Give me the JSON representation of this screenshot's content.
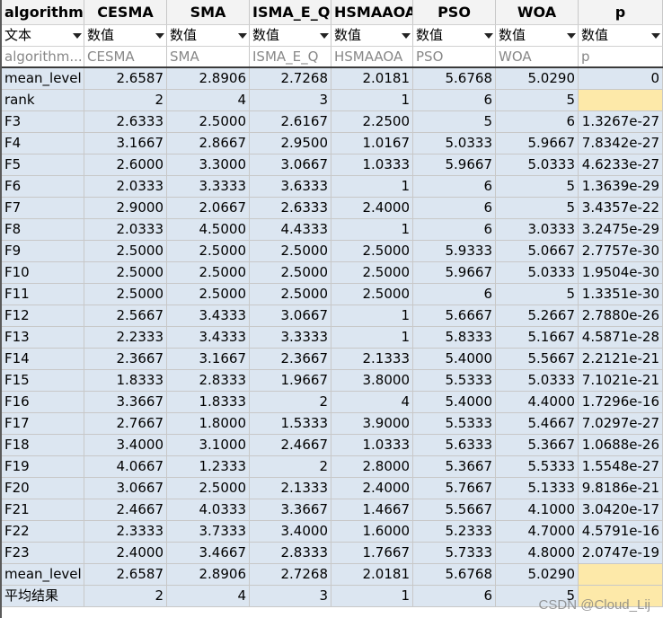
{
  "columns": [
    "algorithm...",
    "CESMA",
    "SMA",
    "ISMA_E_Q",
    "HSMAAOA",
    "PSO",
    "WOA",
    "p"
  ],
  "types": [
    "文本",
    "数值",
    "数值",
    "数值",
    "数值",
    "数值",
    "数值",
    "数值"
  ],
  "placeholders": [
    "algorithm...",
    "CESMA",
    "SMA",
    "ISMA_E_Q",
    "HSMAAOA",
    "PSO",
    "WOA",
    "p"
  ],
  "rows": [
    [
      "mean_level",
      "2.6587",
      "2.8906",
      "2.7268",
      "2.0181",
      "5.6768",
      "5.0290",
      "0"
    ],
    [
      "rank",
      "2",
      "4",
      "3",
      "1",
      "6",
      "5",
      ""
    ],
    [
      "F3",
      "2.6333",
      "2.5000",
      "2.6167",
      "2.2500",
      "5",
      "6",
      "1.3267e-27"
    ],
    [
      "F4",
      "3.1667",
      "2.8667",
      "2.9500",
      "1.0167",
      "5.0333",
      "5.9667",
      "7.8342e-27"
    ],
    [
      "F5",
      "2.6000",
      "3.3000",
      "3.0667",
      "1.0333",
      "5.9667",
      "5.0333",
      "4.6233e-27"
    ],
    [
      "F6",
      "2.0333",
      "3.3333",
      "3.6333",
      "1",
      "6",
      "5",
      "1.3639e-29"
    ],
    [
      "F7",
      "2.9000",
      "2.0667",
      "2.6333",
      "2.4000",
      "6",
      "5",
      "3.4357e-22"
    ],
    [
      "F8",
      "2.0333",
      "4.5000",
      "4.4333",
      "1",
      "6",
      "3.0333",
      "3.2475e-29"
    ],
    [
      "F9",
      "2.5000",
      "2.5000",
      "2.5000",
      "2.5000",
      "5.9333",
      "5.0667",
      "2.7757e-30"
    ],
    [
      "F10",
      "2.5000",
      "2.5000",
      "2.5000",
      "2.5000",
      "5.9667",
      "5.0333",
      "1.9504e-30"
    ],
    [
      "F11",
      "2.5000",
      "2.5000",
      "2.5000",
      "2.5000",
      "6",
      "5",
      "1.3351e-30"
    ],
    [
      "F12",
      "2.5667",
      "3.4333",
      "3.0667",
      "1",
      "5.6667",
      "5.2667",
      "2.7880e-26"
    ],
    [
      "F13",
      "2.2333",
      "3.4333",
      "3.3333",
      "1",
      "5.8333",
      "5.1667",
      "4.5871e-28"
    ],
    [
      "F14",
      "2.3667",
      "3.1667",
      "2.3667",
      "2.1333",
      "5.4000",
      "5.5667",
      "2.2121e-21"
    ],
    [
      "F15",
      "1.8333",
      "2.8333",
      "1.9667",
      "3.8000",
      "5.5333",
      "5.0333",
      "7.1021e-21"
    ],
    [
      "F16",
      "3.3667",
      "1.8333",
      "2",
      "4",
      "5.4000",
      "4.4000",
      "1.7296e-16"
    ],
    [
      "F17",
      "2.7667",
      "1.8000",
      "1.5333",
      "3.9000",
      "5.5333",
      "5.4667",
      "7.0297e-27"
    ],
    [
      "F18",
      "3.4000",
      "3.1000",
      "2.4667",
      "1.0333",
      "5.6333",
      "5.3667",
      "1.0688e-26"
    ],
    [
      "F19",
      "4.0667",
      "1.2333",
      "2",
      "2.8000",
      "5.3667",
      "5.5333",
      "1.5548e-27"
    ],
    [
      "F20",
      "3.0667",
      "2.5000",
      "2.1333",
      "2.4000",
      "5.7667",
      "5.1333",
      "9.8186e-21"
    ],
    [
      "F21",
      "2.4667",
      "4.0333",
      "3.3667",
      "1.4667",
      "5.5667",
      "4.1000",
      "3.0420e-17"
    ],
    [
      "F22",
      "2.3333",
      "3.7333",
      "3.4000",
      "1.6000",
      "5.2333",
      "4.7000",
      "4.5791e-16"
    ],
    [
      "F23",
      "2.4000",
      "3.4667",
      "2.8333",
      "1.7667",
      "5.7333",
      "4.8000",
      "2.0747e-19"
    ],
    [
      "mean_level",
      "2.6587",
      "2.8906",
      "2.7268",
      "2.0181",
      "5.6768",
      "5.0290",
      ""
    ],
    [
      "平均结果",
      "2",
      "4",
      "3",
      "1",
      "6",
      "5",
      ""
    ]
  ],
  "highlighted_cells": [
    [
      1,
      7
    ],
    [
      23,
      7
    ],
    [
      24,
      7
    ]
  ],
  "colors": {
    "cell_bg": "#dce6f1",
    "highlight": "#fde9a9"
  },
  "watermark": "CSDN @Cloud_Lij"
}
